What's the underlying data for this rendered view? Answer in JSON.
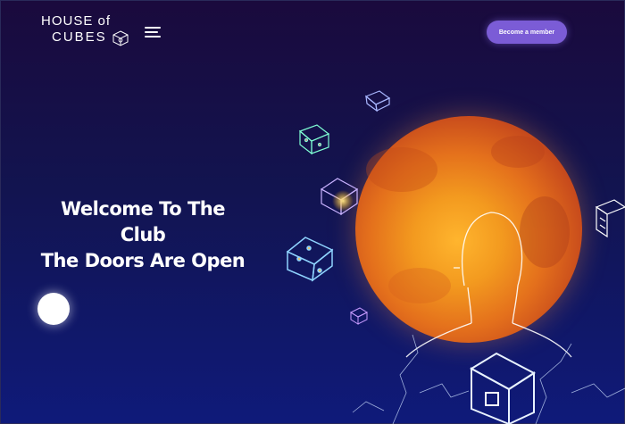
{
  "header": {
    "logo_line1": "HOUSE of",
    "logo_line2": "CUBES",
    "cta_label": "Become a member"
  },
  "hero": {
    "line1": "Welcome To The",
    "line2": "Club",
    "line3": "The Doors Are Open"
  },
  "icons": {
    "menu": "hamburger-menu-icon",
    "logo_cube": "cube-icon"
  },
  "colors": {
    "cta_bg": "#7b5cd6",
    "bg_top": "#1a0a3d",
    "bg_bottom": "#0f1a7a",
    "planet": "#e4701c"
  }
}
